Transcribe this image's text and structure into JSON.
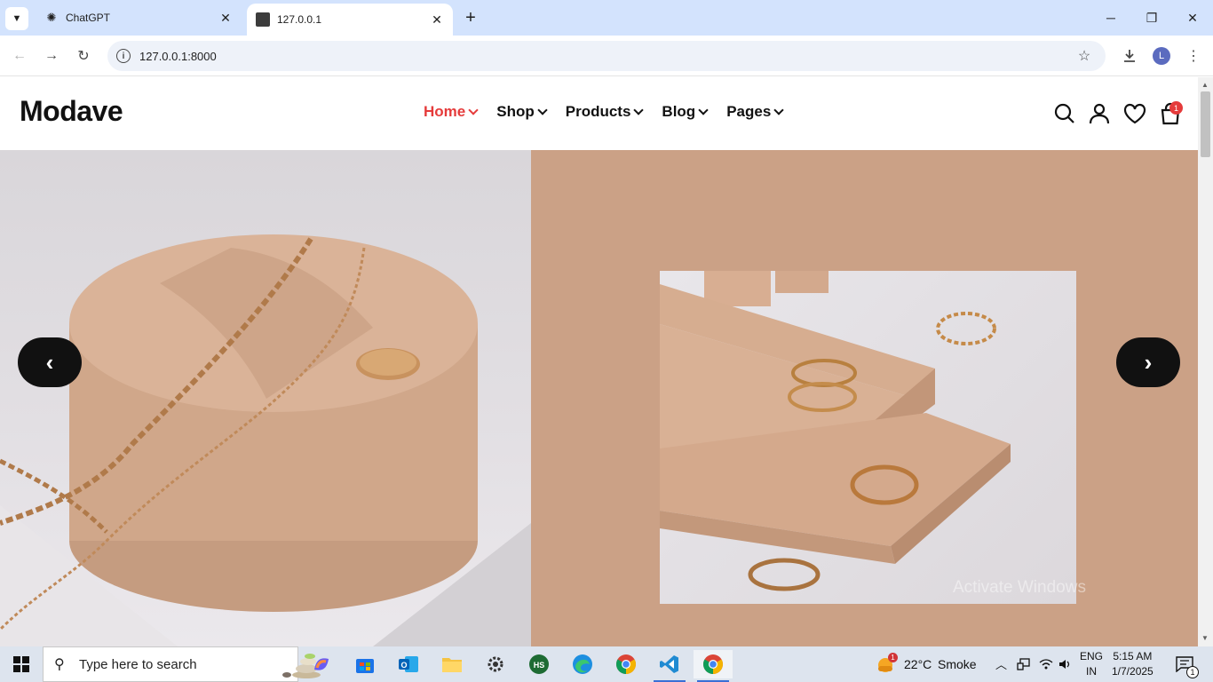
{
  "browser": {
    "tabs": [
      {
        "title": "ChatGPT",
        "active": false
      },
      {
        "title": "127.0.0.1",
        "active": true
      }
    ],
    "url": "127.0.0.1:8000",
    "profile_initial": "L"
  },
  "site": {
    "logo": "Modave",
    "nav": [
      {
        "label": "Home",
        "active": true
      },
      {
        "label": "Shop",
        "active": false
      },
      {
        "label": "Products",
        "active": false
      },
      {
        "label": "Blog",
        "active": false
      },
      {
        "label": "Pages",
        "active": false
      }
    ],
    "cart_count": "1",
    "accent_color": "#e53b3b",
    "hero": {
      "prev_label": "‹",
      "next_label": "›",
      "left_image": "necklace-on-pedestal-photo",
      "right_image": "rings-on-blocks-photo"
    }
  },
  "os": {
    "watermark": "Activate Windows",
    "search_placeholder": "Type here to search",
    "weather": {
      "temp": "22°C",
      "condition": "Smoke",
      "alert_count": "1"
    },
    "language": {
      "lang": "ENG",
      "region": "IN"
    },
    "clock": {
      "time": "5:15 AM",
      "date": "1/7/2025"
    },
    "notification_count": "1"
  }
}
